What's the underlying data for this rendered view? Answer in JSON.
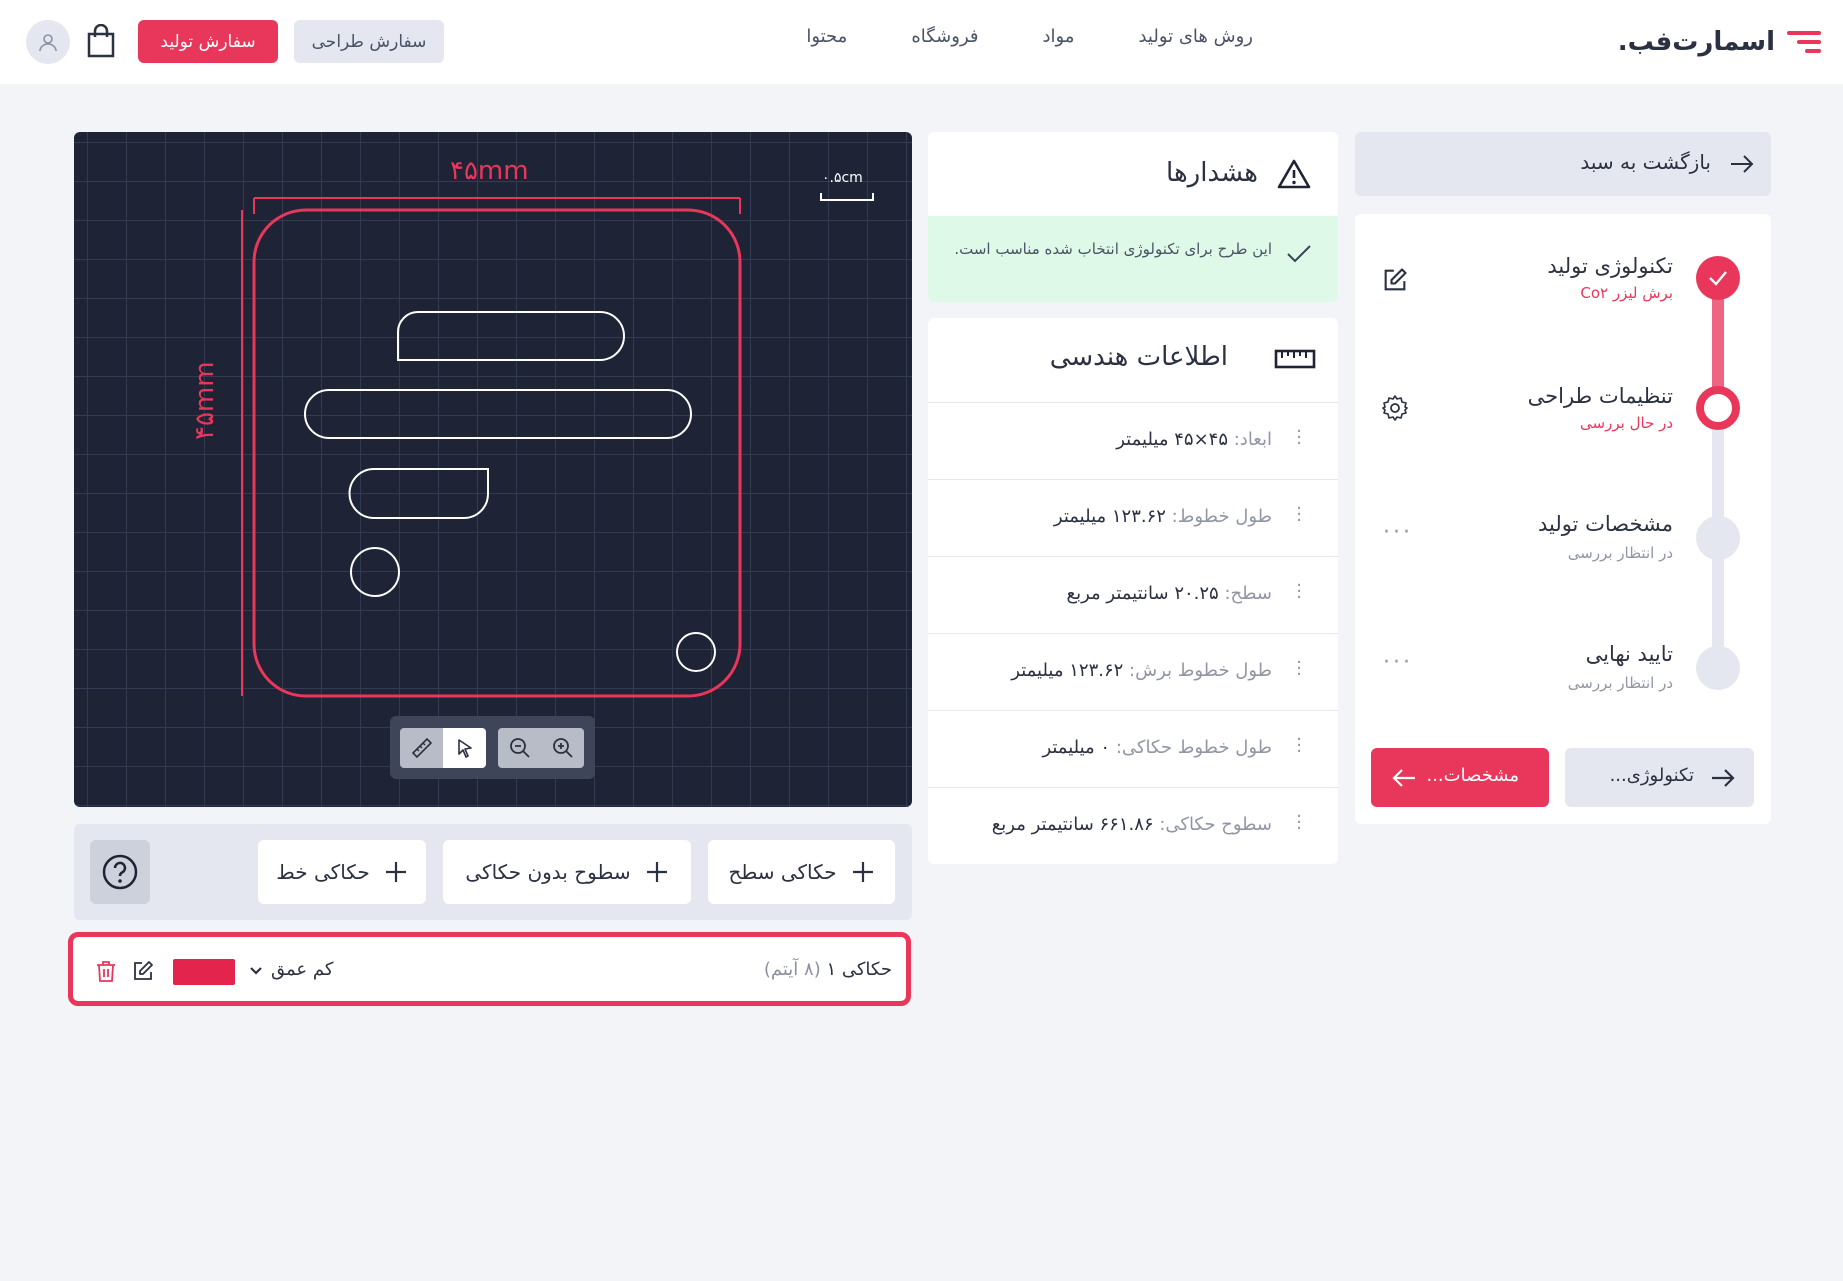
{
  "header": {
    "logo_text": "اسمارت‌فب.",
    "nav": [
      "روش های تولید",
      "مواد",
      "فروشگاه",
      "محتوا"
    ],
    "order_button": "سفارش تولید",
    "design_button": "سفارش طراحی"
  },
  "canvas": {
    "width_label": "۴۵mm",
    "height_label": "۴۵mm",
    "scale_label": "۰.۵cm"
  },
  "actions": {
    "surface_engrave": "حکاکی سطح",
    "surfaces_no_engrave": "سطوح بدون حکاکی",
    "line_engrave": "حکاکی خط"
  },
  "layer": {
    "name": "حکاکی ۱",
    "count": "(۸ آیتم)",
    "depth": "کم عمق",
    "color": "#e3254e"
  },
  "warnings": {
    "title": "هشدارها",
    "ok_message": "این طرح برای تکنولوژی انتخاب شده مناسب است."
  },
  "geometry": {
    "title": "اطلاعات هندسی",
    "rows": [
      {
        "label": "ابعاد:",
        "value": "۴۵×۴۵ میلیمتر"
      },
      {
        "label": "طول خطوط:",
        "value": "۱۲۳.۶۲ میلیمتر"
      },
      {
        "label": "سطح:",
        "value": "۲۰.۲۵ سانتیمتر مربع"
      },
      {
        "label": "طول خطوط برش:",
        "value": "۱۲۳.۶۲ میلیمتر"
      },
      {
        "label": "طول خطوط حکاکی:",
        "value": "۰ میلیمتر"
      },
      {
        "label": "سطوح حکاکی:",
        "value": "۶۶۱.۸۶ سانتیمتر مربع"
      }
    ]
  },
  "steps": {
    "back": "بازگشت به سبد",
    "items": [
      {
        "title": "تکنولوژی تولید",
        "status": "برش لیزر Co۲"
      },
      {
        "title": "تنظیمات طراحی",
        "status": "در حال بررسی"
      },
      {
        "title": "مشخصات تولید",
        "status": "در انتظار بررسی"
      },
      {
        "title": "تایید نهایی",
        "status": "در انتظار بررسی"
      }
    ],
    "next_button": "مشخصات...",
    "prev_button": "تکنولوژی...",
    "accent": "#e8375a"
  }
}
